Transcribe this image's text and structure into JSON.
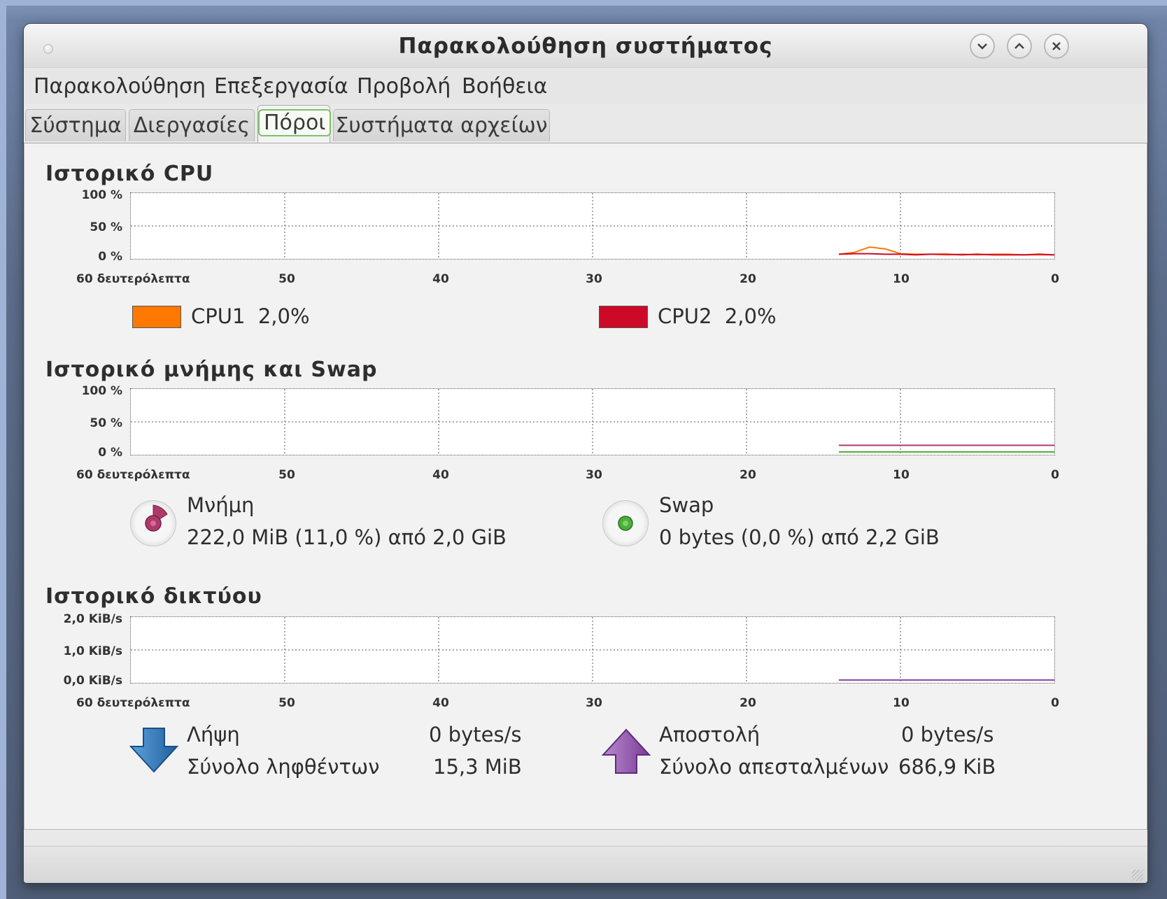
{
  "window": {
    "title": "Παρακολούθηση συστήματος"
  },
  "menubar": {
    "items": [
      "Παρακολούθηση",
      "Επεξεργασία",
      "Προβολή",
      "Βοήθεια"
    ]
  },
  "tabs": [
    "Σύστημα",
    "Διεργασίες",
    "Πόροι",
    "Συστήματα αρχείων"
  ],
  "active_tab": "Πόροι",
  "cpu": {
    "title": "Ιστορικό CPU",
    "y_ticks": [
      "100 %",
      "50 %",
      "0 %"
    ],
    "x_ticks": [
      "60 δευτερόλεπτα",
      "50",
      "40",
      "30",
      "20",
      "10",
      "0"
    ],
    "legend": [
      {
        "name": "CPU1",
        "value": "2,0%",
        "color": "#ff7800"
      },
      {
        "name": "CPU2",
        "value": "2,0%",
        "color": "#cc0a28"
      }
    ]
  },
  "memory": {
    "title": "Ιστορικό μνήμης και Swap",
    "y_ticks": [
      "100 %",
      "50 %",
      "0 %"
    ],
    "x_ticks": [
      "60 δευτερόλεπτα",
      "50",
      "40",
      "30",
      "20",
      "10",
      "0"
    ],
    "mem_label": "Μνήμη",
    "mem_value": "222,0 MiB (11,0 %) από 2,0 GiB",
    "swap_label": "Swap",
    "swap_value": "0 bytes (0,0 %) από 2,2 GiB",
    "mem_color": "#ad3a6b",
    "swap_color": "#4caf3a"
  },
  "network": {
    "title": "Ιστορικό δικτύου",
    "y_ticks": [
      "2,0 KiB/s",
      "1,0 KiB/s",
      "0,0 KiB/s"
    ],
    "x_ticks": [
      "60 δευτερόλεπτα",
      "50",
      "40",
      "30",
      "20",
      "10",
      "0"
    ],
    "receive_label": "Λήψη",
    "receive_rate": "0 bytes/s",
    "received_total_label": "Σύνολο ληφθέντων",
    "received_total": "15,3 MiB",
    "send_label": "Αποστολή",
    "send_rate": "0 bytes/s",
    "sent_total_label": "Σύνολο απεσταλμένων",
    "sent_total": "686,9 KiB",
    "receive_color": "#2f6fb0",
    "send_color": "#8a4aa8"
  },
  "chart_data": [
    {
      "type": "line",
      "title": "Ιστορικό CPU",
      "x": [
        14,
        13,
        12,
        11,
        10,
        9,
        8,
        7,
        6,
        5,
        4,
        3,
        2,
        1,
        0
      ],
      "ylim": [
        0,
        100
      ],
      "series": [
        {
          "name": "CPU1",
          "values": [
            3,
            6,
            15,
            12,
            4,
            3,
            3,
            2,
            3,
            2,
            3,
            3,
            2,
            2,
            2
          ]
        },
        {
          "name": "CPU2",
          "values": [
            3,
            4,
            4,
            3,
            3,
            2,
            3,
            3,
            2,
            3,
            2,
            2,
            2,
            3,
            2
          ]
        }
      ]
    },
    {
      "type": "line",
      "title": "Ιστορικό μνήμης και Swap",
      "x": [
        14,
        0
      ],
      "ylim": [
        0,
        100
      ],
      "series": [
        {
          "name": "Μνήμη",
          "values": [
            11,
            11
          ]
        },
        {
          "name": "Swap",
          "values": [
            0,
            0
          ]
        }
      ]
    },
    {
      "type": "line",
      "title": "Ιστορικό δικτύου",
      "x": [
        14,
        0
      ],
      "ylim": [
        0,
        2
      ],
      "series": [
        {
          "name": "Λήψη",
          "values": [
            0,
            0
          ]
        },
        {
          "name": "Αποστολή",
          "values": [
            0,
            0
          ]
        }
      ]
    }
  ]
}
